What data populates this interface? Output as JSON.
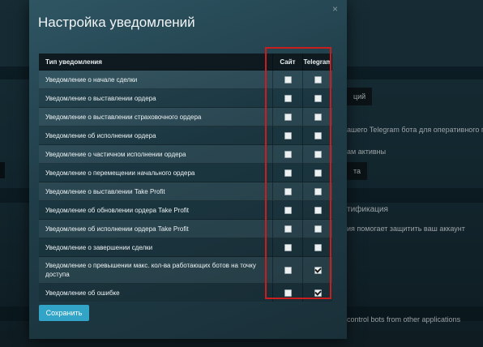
{
  "background": {
    "btn_top": "ций",
    "telegram_hint": "ашего Telegram бота для оперативного пол",
    "active_text": "ам активны",
    "btn_mid": "та",
    "section_title": "тификация",
    "protect_text": "ия помогает защитить ваш аккаунт",
    "bottom_text": "control bots from other applications"
  },
  "modal": {
    "title": "Настройка уведомлений",
    "close_symbol": "×",
    "table": {
      "headers": {
        "type": "Тип уведомления",
        "site": "Сайт",
        "telegram": "Telegram"
      },
      "rows": [
        {
          "label": "Уведомление о начале сделки",
          "site": false,
          "telegram": false
        },
        {
          "label": "Уведомление о выставлении ордера",
          "site": false,
          "telegram": false
        },
        {
          "label": "Уведомление о выставлении страховочного ордера",
          "site": false,
          "telegram": false
        },
        {
          "label": "Уведомление об исполнении ордера",
          "site": false,
          "telegram": false
        },
        {
          "label": "Уведомление о частичном исполнении ордера",
          "site": false,
          "telegram": false
        },
        {
          "label": "Уведомление о перемещении начального ордера",
          "site": false,
          "telegram": false
        },
        {
          "label": "Уведомление о выставлении Take Profit",
          "site": false,
          "telegram": false
        },
        {
          "label": "Уведомление об обновлении ордера Take Profit",
          "site": false,
          "telegram": false
        },
        {
          "label": "Уведомление об исполнении ордера Take Profit",
          "site": false,
          "telegram": false
        },
        {
          "label": "Уведомление о завершении сделки",
          "site": false,
          "telegram": false
        },
        {
          "label": "Уведомление о превышении макс. кол-ва работающих ботов на точку доступа",
          "site": false,
          "telegram": true
        },
        {
          "label": "Уведомление об ошибке",
          "site": false,
          "telegram": true
        }
      ]
    },
    "save_label": "Сохранить"
  },
  "colors": {
    "accent": "#31a4c8",
    "highlight": "#c81e1e",
    "modal_bg": "#2a4a56"
  }
}
